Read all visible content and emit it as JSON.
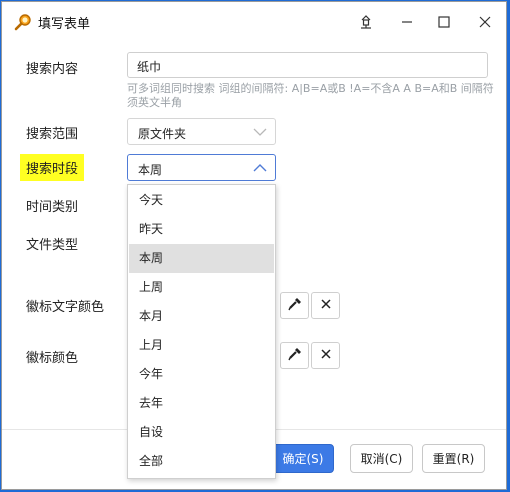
{
  "window": {
    "title": "填写表单"
  },
  "form": {
    "search_content": {
      "label": "搜索内容",
      "value": "纸巾",
      "hint": "可多词组同时搜索 词组的间隔符: A|B=A或B !A=不含A  A B=A和B 间隔符须英文半角"
    },
    "search_scope": {
      "label": "搜索范围",
      "value": "原文件夹"
    },
    "search_period": {
      "label": "搜索时段",
      "value": "本周",
      "options": [
        "今天",
        "昨天",
        "本周",
        "上周",
        "本月",
        "上月",
        "今年",
        "去年",
        "自设",
        "全部"
      ],
      "selected_index": 2
    },
    "time_type": {
      "label": "时间类别"
    },
    "file_type": {
      "label": "文件类型"
    },
    "badge_text_color": {
      "label": "徽标文字颜色"
    },
    "badge_color": {
      "label": "徽标颜色"
    }
  },
  "buttons": {
    "ok": "确定(S)",
    "cancel": "取消(C)",
    "reset": "重置(R)"
  },
  "colors": {
    "highlight": "#ffff22",
    "primary": "#3c7ae6",
    "desktop": "#1e6bd6"
  }
}
